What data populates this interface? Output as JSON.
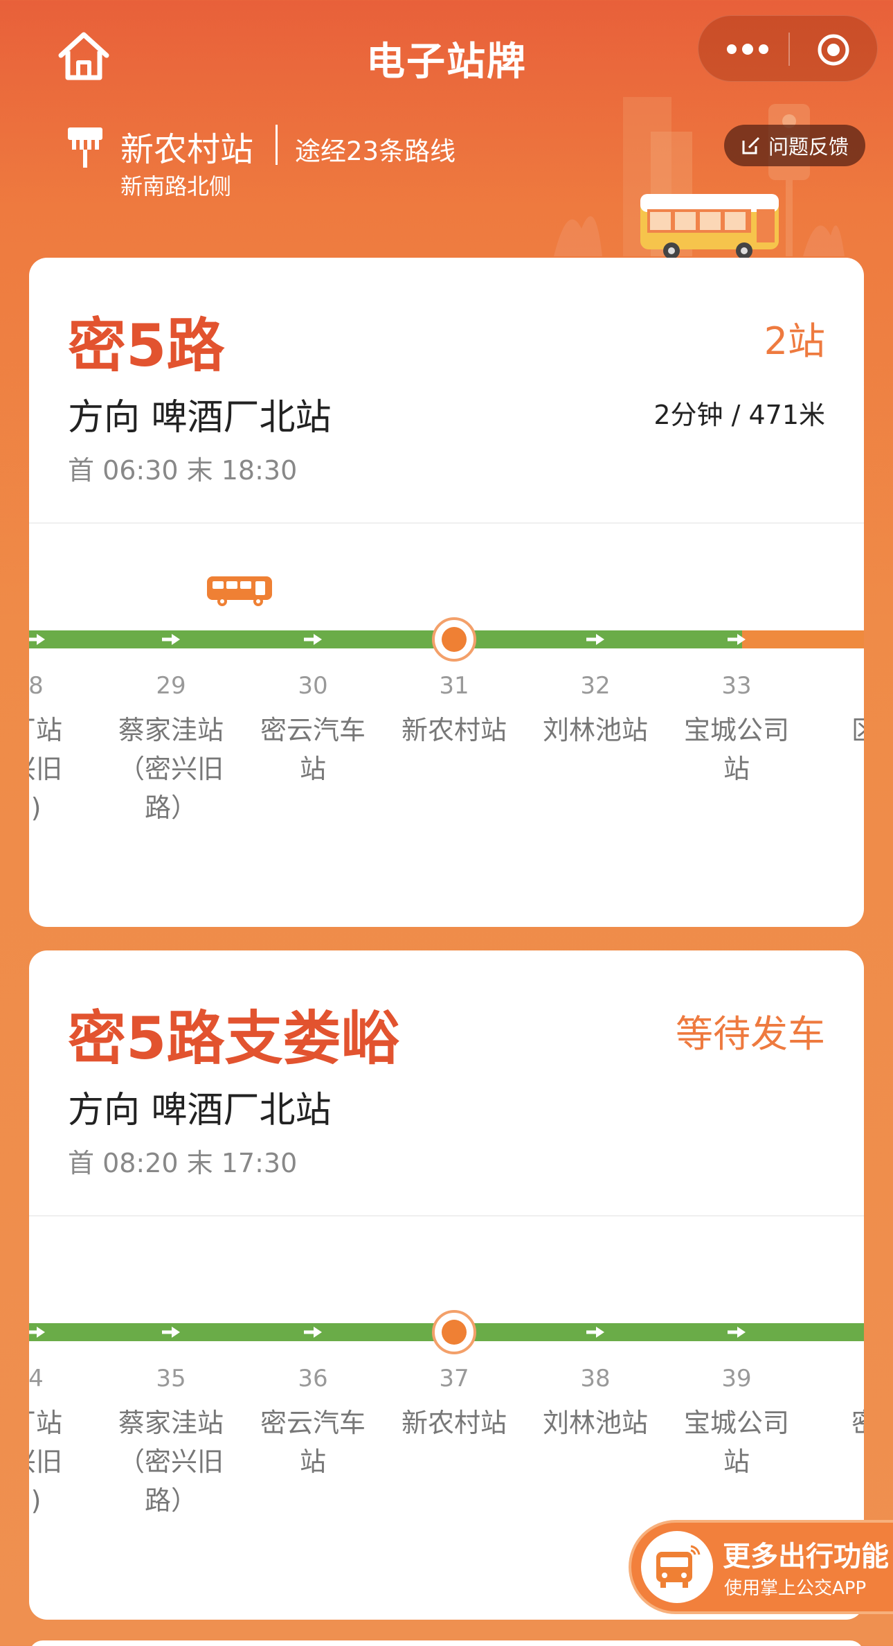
{
  "header": {
    "title": "电子站牌"
  },
  "station": {
    "name": "新农村站",
    "routes_text": "途经23条路线",
    "road": "新南路北侧",
    "feedback_label": "问题反馈"
  },
  "cards": [
    {
      "route_name": "密5路",
      "status": "2站",
      "direction": "方向 啤酒厂北站",
      "eta": "2分钟 / 471米",
      "times": "首 06:30 末 18:30",
      "stops": [
        {
          "num": "8",
          "name": "厂站\n兴旧\n)"
        },
        {
          "num": "29",
          "name": "蔡家洼站\n（密兴旧\n路）"
        },
        {
          "num": "30",
          "name": "密云汽车\n站"
        },
        {
          "num": "31",
          "name": "新农村站"
        },
        {
          "num": "32",
          "name": "刘林池站"
        },
        {
          "num": "33",
          "name": "宝城公司\n站"
        },
        {
          "num": "",
          "name": "区工"
        }
      ]
    },
    {
      "route_name": "密5路支娄峪",
      "status": "等待发车",
      "direction": "方向 啤酒厂北站",
      "eta": "",
      "times": "首 08:20 末 17:30",
      "stops": [
        {
          "num": "4",
          "name": "厂站\n兴旧\n)"
        },
        {
          "num": "35",
          "name": "蔡家洼站\n（密兴旧\n路）"
        },
        {
          "num": "36",
          "name": "密云汽车\n站"
        },
        {
          "num": "37",
          "name": "新农村站"
        },
        {
          "num": "38",
          "name": "刘林池站"
        },
        {
          "num": "39",
          "name": "宝城公司\n站"
        },
        {
          "num": "",
          "name": "密云"
        }
      ]
    }
  ],
  "promo": {
    "title": "更多出行功能",
    "subtitle": "使用掌上公交APP"
  },
  "colors": {
    "brand": "#e2532f",
    "accent": "#ee7a3f",
    "line_green": "#6aac48",
    "current_stop": "#ef8034"
  },
  "icons": [
    "home-icon",
    "more-dots-icon",
    "target-icon",
    "bus-stop-sign-icon",
    "edit-icon",
    "bus-icon",
    "arrow-right-icon"
  ]
}
